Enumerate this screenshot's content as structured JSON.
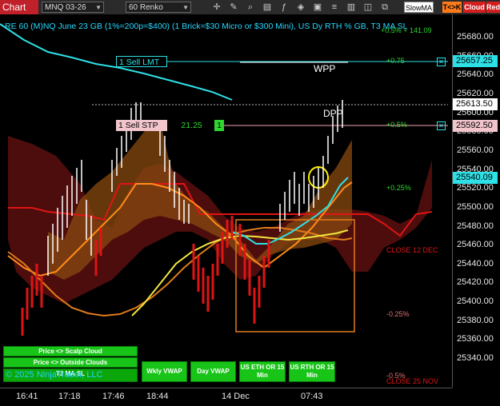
{
  "toolbar": {
    "chart_button": "Chart",
    "instrument": "MNQ 03-26",
    "bar_type": "60 Renko",
    "strategy": "SlowMA",
    "tc_label": "T<>K",
    "cloud_label": "Cloud",
    "red_label": "Red"
  },
  "chart_title": "RE 60 (M)NQ June 23 GB (1%=200p=$400) (1 Brick=$30 Micro or $300 Mini), US Dy RTH % GB, T3 MA SL",
  "orders": {
    "sell_limit_label": "1 Sell LMT",
    "sell_stop_label": "1 Sell STP",
    "stop_pnl": "21.25",
    "stop_qty": "1"
  },
  "annotations": {
    "wpp": "WPP",
    "dpp": "DPP",
    "pct_top_right": "+0.5% + 141.09",
    "pct_075": "+0.75",
    "pct_05": "+0.5%",
    "pct_025": "+0.25%",
    "close_12dec": "CLOSE 12 DEC",
    "pct_neg025": "-0.25%",
    "pct_neg05": "-0.5%",
    "close_25nov": "CLOSE 25 NOV"
  },
  "price_axis": {
    "ticks": [
      "25680.00",
      "25660.00",
      "25640.00",
      "25620.00",
      "25600.00",
      "25580.00",
      "25560.00",
      "25540.00",
      "25520.00",
      "25500.00",
      "25480.00",
      "25460.00",
      "25440.00",
      "25420.00",
      "25400.00",
      "25380.00",
      "25360.00",
      "25340.00"
    ],
    "sell_limit_price": "25657.25",
    "last_price": "25613.50",
    "sell_stop_price": "25592.50",
    "ma_price": "25540.09"
  },
  "time_axis": {
    "ticks": [
      "16:41",
      "17:18",
      "17:46",
      "18:44",
      "14 Dec",
      "07:43"
    ]
  },
  "bottom_buttons": {
    "scalp_cloud": "Price <> Scalp Cloud",
    "outside_clouds": "Price <> Outside Clouds",
    "t3_ma_sl": "T3 MA SL",
    "wkly_vwap": "Wkly VWAP",
    "day_vwap": "Day VWAP",
    "us_eth_or_15": "US ETH OR 15 Min",
    "us_rth_or_15": "US RTH OR 15 Min"
  },
  "copyright": "© 2025 NinjaTrader, LLC",
  "colors": {
    "accent_red": "#c0202a",
    "cyan": "#2de0e6",
    "green": "#18c418",
    "orange": "#ff8c1a",
    "yellow": "#f2e640"
  }
}
